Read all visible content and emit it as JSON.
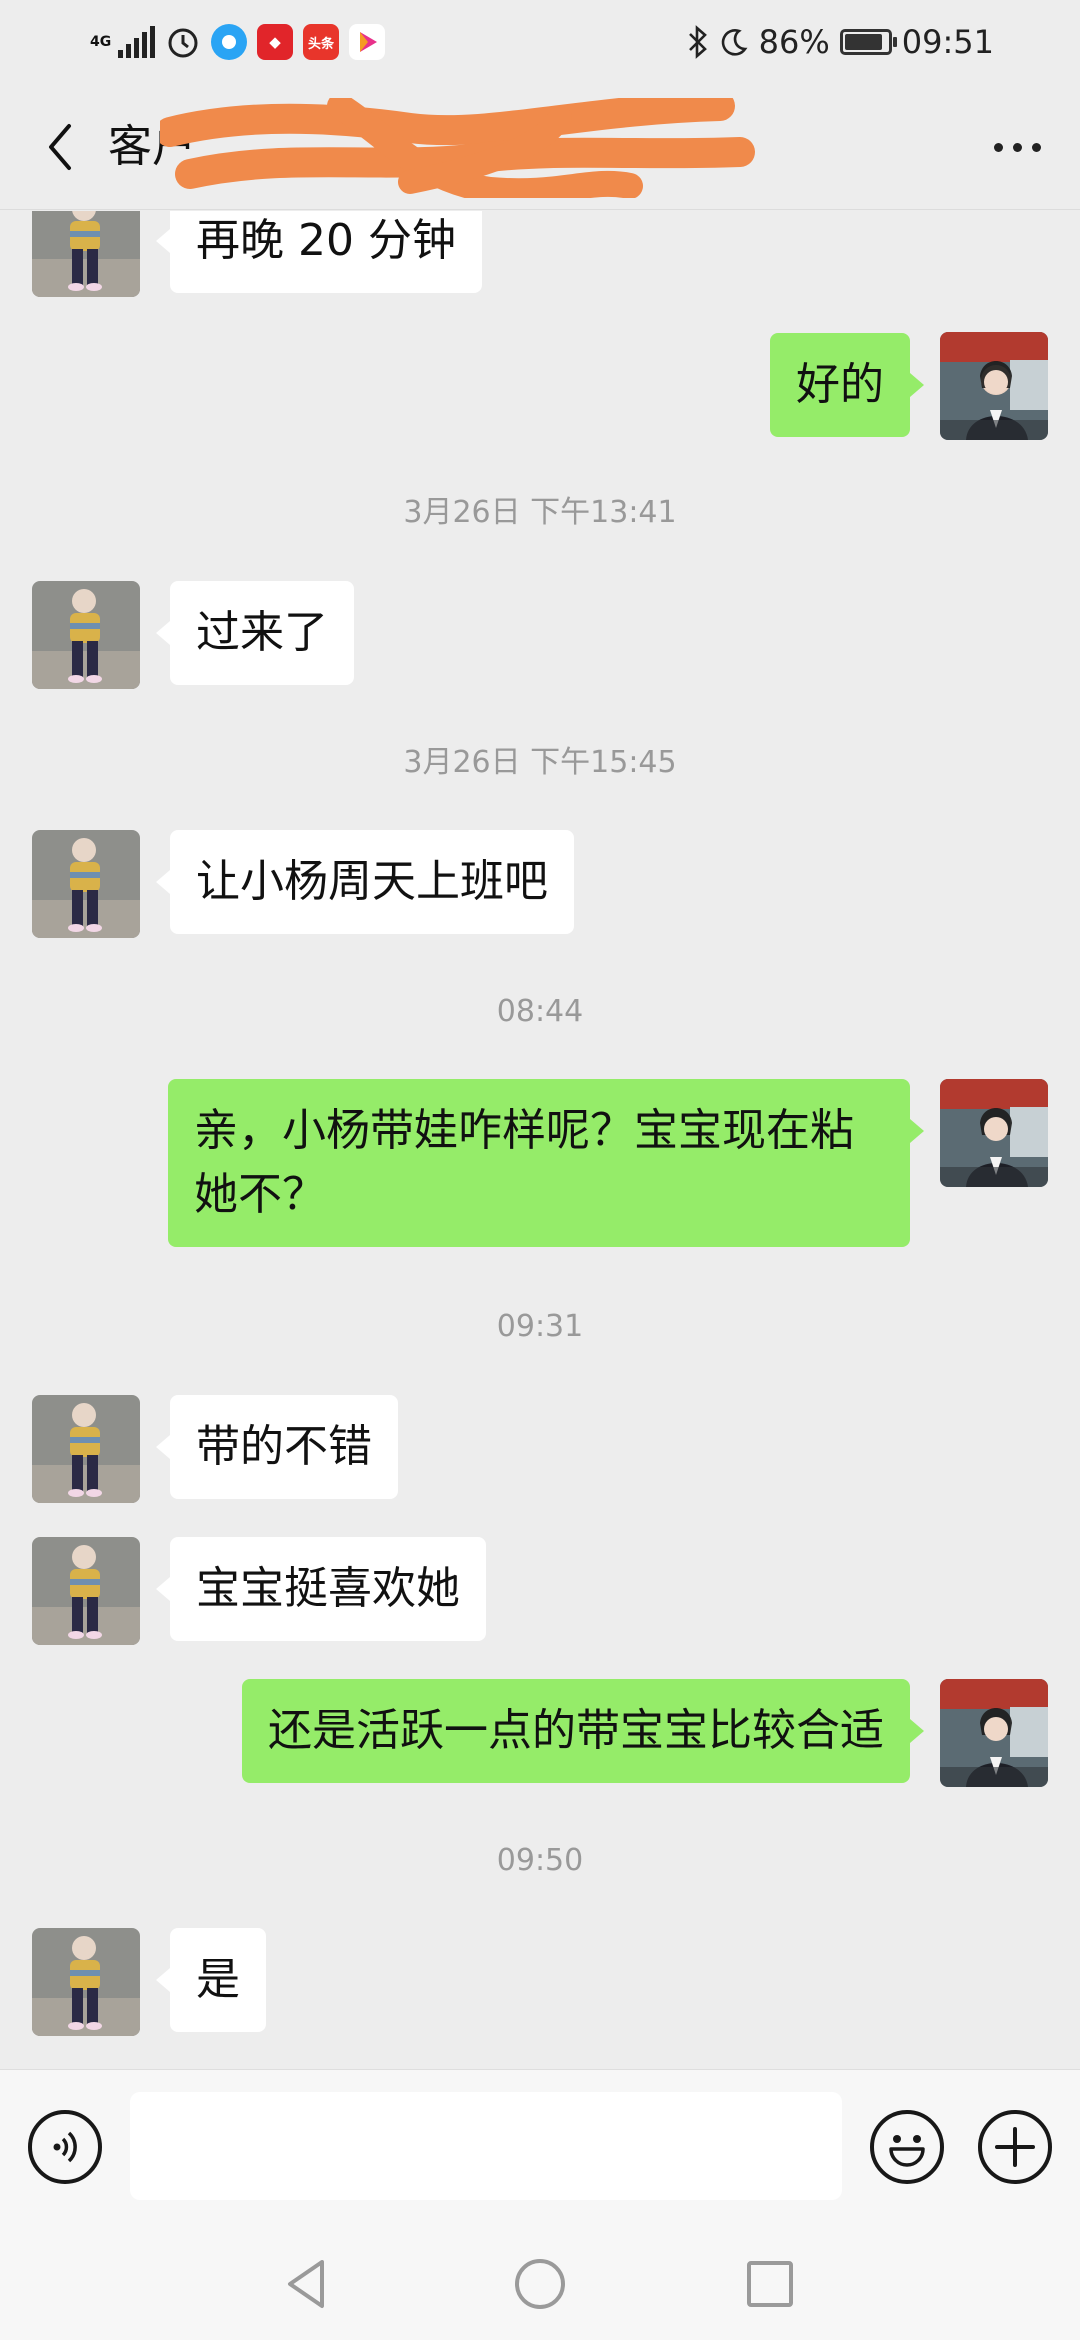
{
  "status_bar": {
    "network": "4G",
    "battery": "86%",
    "time": "09:51",
    "icons": [
      "signal-icon",
      "alarm-icon",
      "browser-app-icon",
      "weibo-app-icon",
      "toutiao-app-icon",
      "video-app-icon",
      "bluetooth-icon",
      "moon-icon",
      "battery-icon"
    ],
    "toutiao_label": "头条"
  },
  "header": {
    "title": "客户",
    "title_redacted": true,
    "back_icon": "chevron-left-icon",
    "more_icon": "more-dots-icon"
  },
  "messages": [
    {
      "type": "in",
      "text": "再晚 20 分钟"
    },
    {
      "type": "out",
      "text": "好的"
    },
    {
      "type": "time",
      "text": "3月26日 下午13:41"
    },
    {
      "type": "in",
      "text": "过来了"
    },
    {
      "type": "time",
      "text": "3月26日 下午15:45"
    },
    {
      "type": "in",
      "text": "让小杨周天上班吧"
    },
    {
      "type": "time",
      "text": "08:44"
    },
    {
      "type": "out",
      "text": "亲，小杨带娃咋样呢？宝宝现在粘她不？"
    },
    {
      "type": "time",
      "text": "09:31"
    },
    {
      "type": "in",
      "text": "带的不错"
    },
    {
      "type": "in",
      "text": "宝宝挺喜欢她"
    },
    {
      "type": "out",
      "text": "还是活跃一点的带宝宝比较合适"
    },
    {
      "type": "time",
      "text": "09:50"
    },
    {
      "type": "in",
      "text": "是"
    }
  ],
  "input_bar": {
    "voice_icon": "voice-icon",
    "emoji_icon": "emoji-icon",
    "plus_icon": "plus-icon",
    "value": ""
  },
  "nav_bar": {
    "icons": [
      "nav-back-icon",
      "nav-home-icon",
      "nav-recents-icon"
    ]
  },
  "colors": {
    "background": "#ededed",
    "bubble_out": "#95ec69",
    "bubble_in": "#ffffff",
    "timestamp": "#999999",
    "redaction": "#f08a4b"
  }
}
